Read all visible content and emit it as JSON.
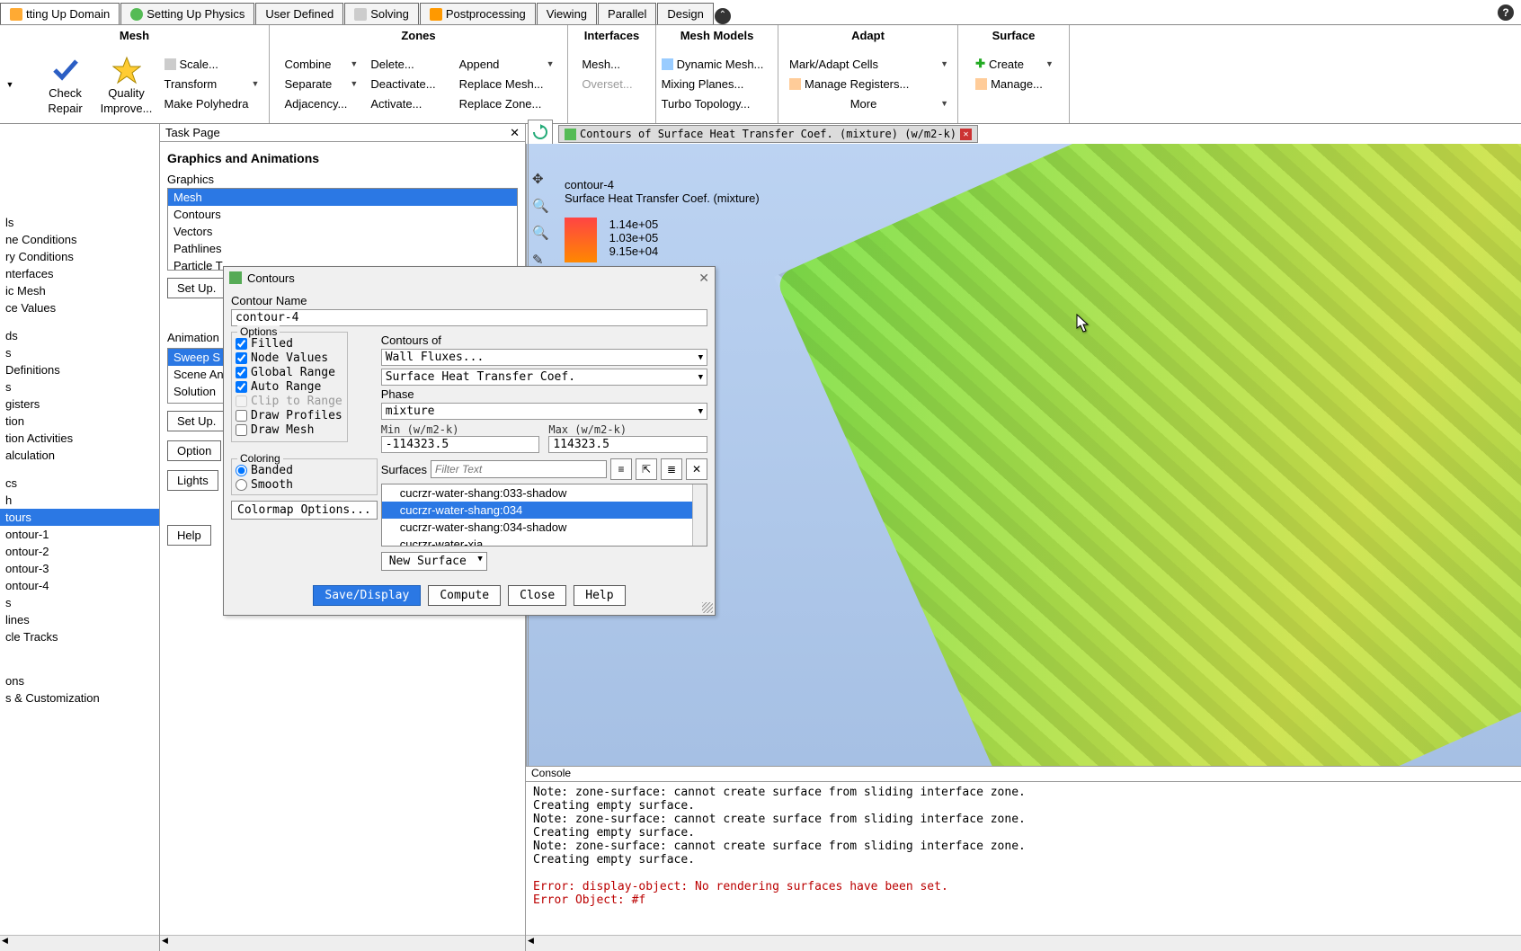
{
  "top_tabs": {
    "domain": "tting Up Domain",
    "physics": "Setting Up Physics",
    "user_defined": "User Defined",
    "solving": "Solving",
    "postprocessing": "Postprocessing",
    "viewing": "Viewing",
    "parallel": "Parallel",
    "design": "Design"
  },
  "ribbon": {
    "mesh": {
      "header": "Mesh",
      "check": "Check",
      "quality": "Quality",
      "repair": "Repair",
      "improve": "Improve...",
      "scale": "Scale...",
      "transform": "Transform",
      "make_poly": "Make Polyhedra"
    },
    "zones": {
      "header": "Zones",
      "combine": "Combine",
      "separate": "Separate",
      "adjacency": "Adjacency...",
      "delete": "Delete...",
      "deactivate": "Deactivate...",
      "activate": "Activate...",
      "append": "Append",
      "replace_mesh": "Replace Mesh...",
      "replace_zone": "Replace Zone..."
    },
    "interfaces": {
      "header": "Interfaces",
      "mesh": "Mesh...",
      "overset": "Overset..."
    },
    "mesh_models": {
      "header": "Mesh Models",
      "dynamic": "Dynamic Mesh...",
      "mixing": "Mixing Planes...",
      "turbo": "Turbo Topology..."
    },
    "adapt": {
      "header": "Adapt",
      "mark": "Mark/Adapt Cells",
      "manage": "Manage Registers...",
      "more": "More"
    },
    "surface": {
      "header": "Surface",
      "create": "Create",
      "manage": "Manage..."
    }
  },
  "left_tree": {
    "items1": [
      "ls",
      "ne Conditions",
      "ry Conditions",
      "nterfaces",
      "ic Mesh",
      "ce Values"
    ],
    "items2": [
      "ds",
      "s",
      "Definitions",
      "s",
      "gisters",
      "tion",
      "tion Activities",
      "alculation"
    ],
    "items3": [
      "cs",
      "h"
    ],
    "sel": "tours",
    "contours": [
      "ontour-1",
      "ontour-2",
      "ontour-3",
      "ontour-4"
    ],
    "items4": [
      "s",
      "lines",
      "cle Tracks"
    ],
    "items5": [
      "ons",
      "s & Customization"
    ]
  },
  "task": {
    "title": "Task Page",
    "heading": "Graphics and Animations",
    "graphics_lbl": "Graphics",
    "graphics_list": [
      "Mesh",
      "Contours",
      "Vectors",
      "Pathlines",
      "Particle T"
    ],
    "animations_lbl": "Animation",
    "anim_list": [
      "Sweep S",
      "Scene An",
      "Solution"
    ],
    "setup": "Set Up.",
    "options": "Option",
    "lights": "Lights",
    "help": "Help"
  },
  "canvas": {
    "tab_title": "Contours of Surface Heat Transfer Coef. (mixture)  (w/m2-k)",
    "contour_name": "contour-4",
    "field": "Surface Heat Transfer Coef. (mixture)",
    "legend": [
      "1.14e+05",
      "1.03e+05",
      "9.15e+04"
    ]
  },
  "dialog": {
    "title": "Contours",
    "name_lbl": "Contour Name",
    "name_val": "contour-4",
    "options_lbl": "Options",
    "opts": {
      "filled": "Filled",
      "node": "Node Values",
      "global": "Global Range",
      "auto": "Auto Range",
      "clip": "Clip to Range",
      "profiles": "Draw Profiles",
      "mesh": "Draw Mesh"
    },
    "coloring_lbl": "Coloring",
    "banded": "Banded",
    "smooth": "Smooth",
    "cmap": "Colormap Options...",
    "contours_of": "Contours of",
    "field_cat": "Wall Fluxes...",
    "field_val": "Surface Heat Transfer Coef.",
    "phase_lbl": "Phase",
    "phase_val": "mixture",
    "min_lbl": "Min (w/m2-k)",
    "min_val": "-114323.5",
    "max_lbl": "Max (w/m2-k)",
    "max_val": "114323.5",
    "surfaces_lbl": "Surfaces",
    "filter_ph": "Filter Text",
    "surf_list": [
      "cucrzr-water-shang:033-shadow",
      "cucrzr-water-shang:034",
      "cucrzr-water-shang:034-shadow",
      "cucrzr-water-xia"
    ],
    "new_surface": "New Surface",
    "save": "Save/Display",
    "compute": "Compute",
    "close": "Close",
    "help": "Help"
  },
  "console": {
    "title": "Console",
    "lines": [
      "Note: zone-surface: cannot create surface from sliding interface zone.",
      "Creating empty surface.",
      "Note: zone-surface: cannot create surface from sliding interface zone.",
      "Creating empty surface.",
      "Note: zone-surface: cannot create surface from sliding interface zone.",
      "Creating empty surface."
    ],
    "err1": "Error: display-object: No rendering surfaces have been set.",
    "err2": "Error Object: #f"
  }
}
